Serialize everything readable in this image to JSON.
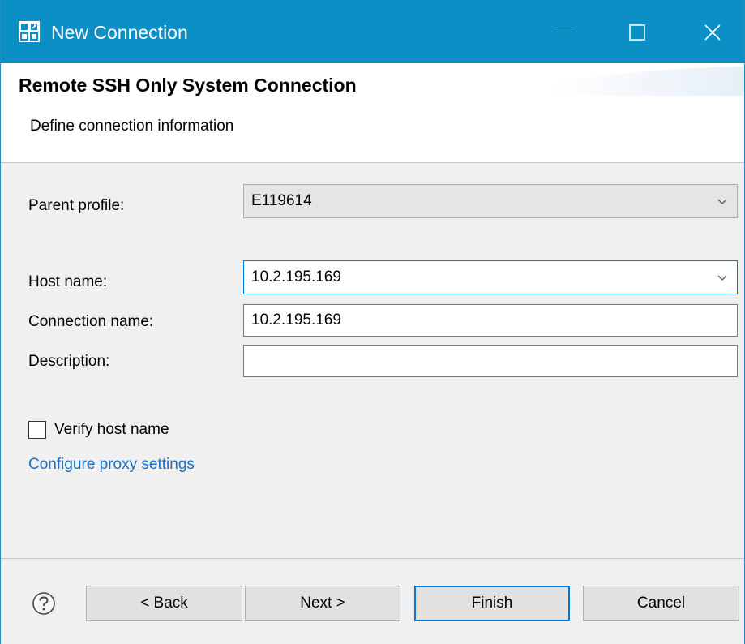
{
  "window": {
    "title": "New Connection",
    "icon": "app-connection-icon",
    "controls": [
      "minimize-icon",
      "maximize-icon",
      "close-icon"
    ]
  },
  "header": {
    "title": "Remote SSH Only System Connection",
    "subtitle": "Define connection information"
  },
  "form": {
    "parent_profile": {
      "label": "Parent profile:",
      "value": "E119614"
    },
    "host_name": {
      "label": "Host name:",
      "value": "10.2.195.169"
    },
    "connection_name": {
      "label": "Connection name:",
      "value": "10.2.195.169"
    },
    "description": {
      "label": "Description:",
      "value": ""
    },
    "verify_host": {
      "label": "Verify host name",
      "checked": false
    },
    "proxy_link": "Configure proxy settings"
  },
  "footer": {
    "help_icon": "help-icon",
    "back": "< Back",
    "next": "Next >",
    "finish": "Finish",
    "cancel": "Cancel"
  },
  "colors": {
    "titlebar": "#0b8fc4",
    "accent": "#0078d7",
    "link": "#1a6fc7",
    "panel": "#f0f0f0"
  }
}
